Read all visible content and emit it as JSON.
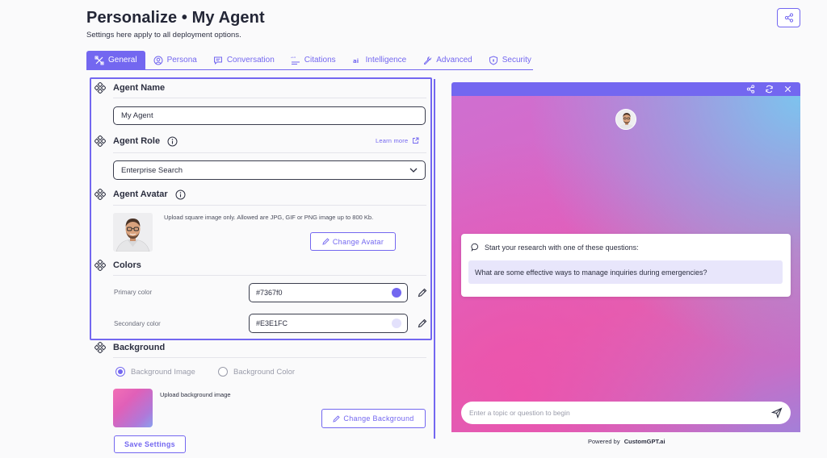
{
  "header": {
    "title": "Personalize • My Agent",
    "subtitle": "Settings here apply to all deployment options."
  },
  "tabs": [
    {
      "label": "General",
      "icon": "tools-icon",
      "active": true
    },
    {
      "label": "Persona",
      "icon": "user-circle-icon",
      "active": false
    },
    {
      "label": "Conversation",
      "icon": "message-icon",
      "active": false
    },
    {
      "label": "Citations",
      "icon": "citation-icon",
      "active": false
    },
    {
      "label": "Intelligence",
      "icon": "ai-icon",
      "active": false
    },
    {
      "label": "Advanced",
      "icon": "wrench-icon",
      "active": false
    },
    {
      "label": "Security",
      "icon": "shield-icon",
      "active": false
    }
  ],
  "agent_name": {
    "heading": "Agent Name",
    "value": "My Agent"
  },
  "agent_role": {
    "heading": "Agent Role",
    "learn_more": "Learn more",
    "selected": "Enterprise Search"
  },
  "agent_avatar": {
    "heading": "Agent Avatar",
    "note": "Upload square image only. Allowed are JPG, GIF or PNG image up to 800 Kb.",
    "button": "Change Avatar"
  },
  "colors": {
    "heading": "Colors",
    "primary_label": "Primary color",
    "primary_value": "#7367f0",
    "secondary_label": "Secondary color",
    "secondary_value": "#E3E1FC"
  },
  "background": {
    "heading": "Background",
    "option_image": "Background Image",
    "option_color": "Background Color",
    "selected": "Background Image",
    "upload_note": "Upload background image",
    "button": "Change Background"
  },
  "save_button": "Save Settings",
  "preview": {
    "starter_heading": "Start your research with one of these questions:",
    "starter_question": "What are some effective ways to manage inquiries during emergencies?",
    "input_placeholder": "Enter a topic or question to begin",
    "powered_prefix": "Powered by",
    "powered_brand": "CustomGPT.ai"
  },
  "theme": {
    "accent": "#7367f0",
    "accent_light": "#E3E1FC"
  }
}
